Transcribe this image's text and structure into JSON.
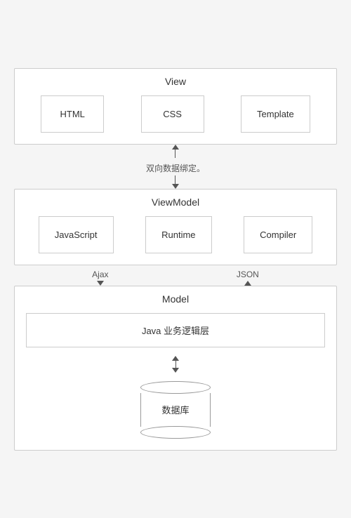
{
  "view": {
    "title": "View",
    "boxes": [
      {
        "label": "HTML"
      },
      {
        "label": "CSS"
      },
      {
        "label": "Template"
      }
    ]
  },
  "binding_label": "双向数据绑定。",
  "viewmodel": {
    "title": "ViewModel",
    "boxes": [
      {
        "label": "JavaScript"
      },
      {
        "label": "Runtime"
      },
      {
        "label": "Compiler"
      }
    ]
  },
  "ajax_label": "Ajax",
  "json_label": "JSON",
  "model": {
    "title": "Model",
    "java_label": "Java 业务逻辑层",
    "db_label": "数据库"
  }
}
